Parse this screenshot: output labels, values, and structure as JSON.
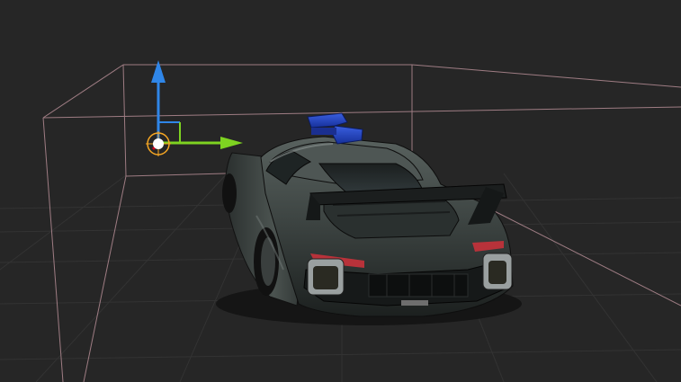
{
  "viewport": {
    "background": "#262626",
    "grid_color": "#333333",
    "bounds_color": "#b48c94"
  },
  "gizmo": {
    "axis_x_color": "#7ed321",
    "axis_y_color": "#2f86e8",
    "axis_z_color": "#d0021b",
    "pivot_color": "#ffffff",
    "pivot_ring_color": "#f5a623",
    "icons": [
      "move-arrow-x-icon",
      "move-arrow-y-icon",
      "pivot-icon"
    ]
  },
  "model": {
    "body_color": "#3b4240",
    "light_bar_color": "#1f3fbf",
    "taillight_color": "#b8323a"
  }
}
